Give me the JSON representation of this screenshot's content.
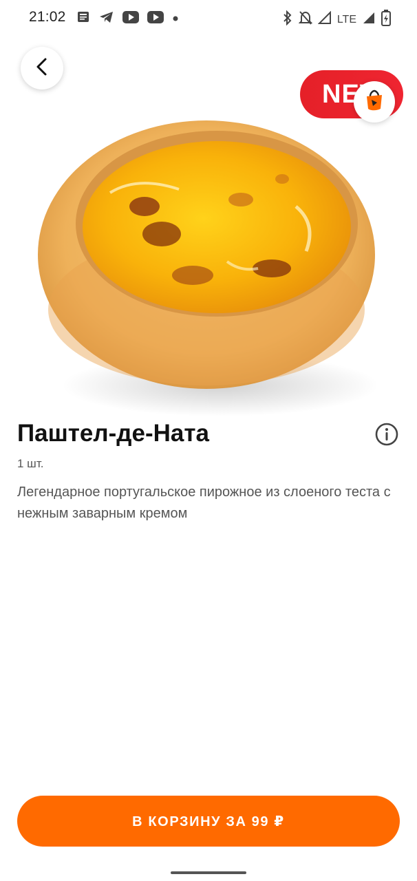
{
  "status_bar": {
    "time": "21:02",
    "network": "LTE",
    "left_icons": [
      "news-icon",
      "telegram-icon",
      "youtube-icon",
      "youtube-icon",
      "dot-icon"
    ],
    "right_icons": [
      "bluetooth-icon",
      "bell-off-icon",
      "signal-icon",
      "signal-icon",
      "battery-charging-icon"
    ]
  },
  "hero": {
    "badge_label": "NEW",
    "badge_color": "#e52028",
    "back_icon": "chevron-left-icon",
    "cart_icon": "shopping-bag-icon"
  },
  "product": {
    "title": "Паштел-де-Ната",
    "quantity": "1 шт.",
    "description": "Легендарное португальское пирожное из слоеного теста с нежным заварным кремом",
    "info_icon": "info-icon"
  },
  "cta": {
    "label": "В КОРЗИНУ ЗА 99 ₽",
    "color": "#ff6a00"
  }
}
